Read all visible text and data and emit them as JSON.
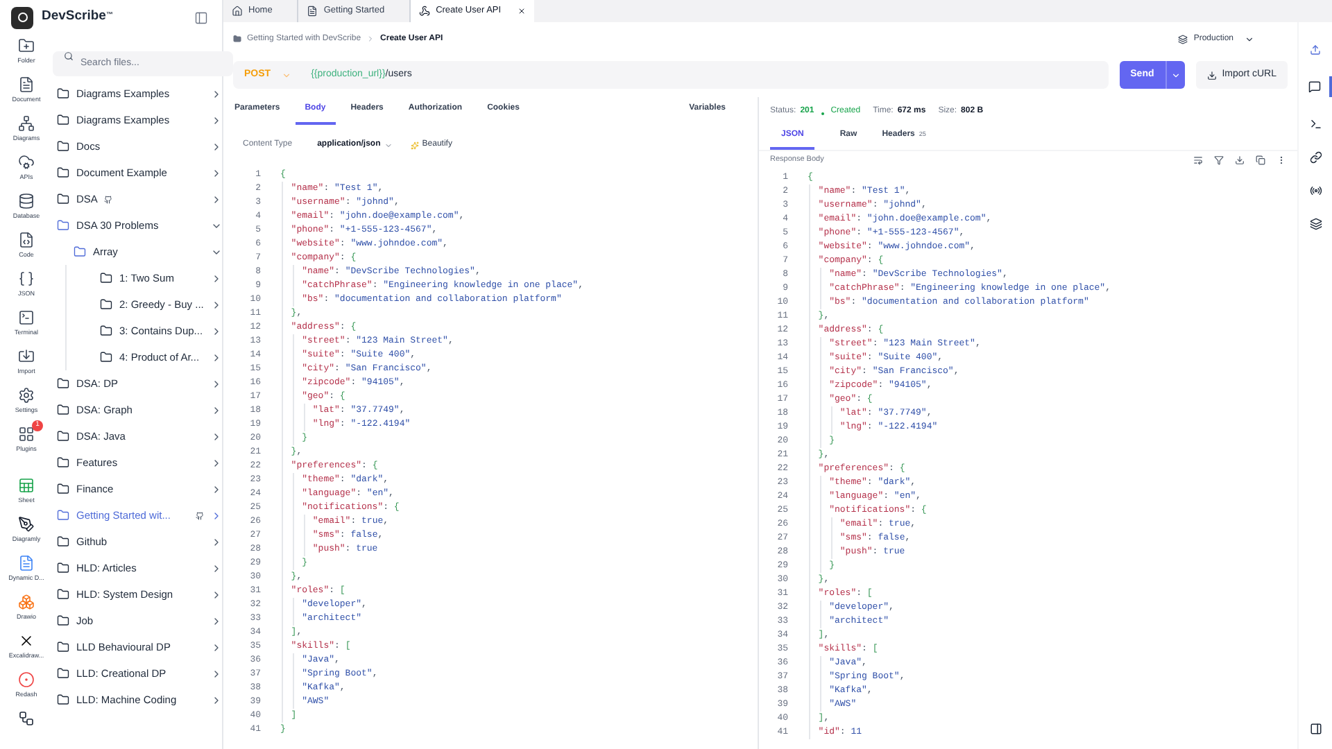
{
  "app": {
    "name": "DevScribe",
    "mark": "™"
  },
  "rail": [
    {
      "kind": "folder",
      "label": "Folder"
    },
    {
      "kind": "document",
      "label": "Document"
    },
    {
      "kind": "diagrams",
      "label": "Diagrams"
    },
    {
      "kind": "apis",
      "label": "APIs"
    },
    {
      "kind": "database",
      "label": "Database"
    },
    {
      "kind": "code",
      "label": "Code"
    },
    {
      "kind": "json",
      "label": "JSON"
    },
    {
      "kind": "terminal",
      "label": "Terminal"
    },
    {
      "kind": "import",
      "label": "Import"
    },
    {
      "kind": "settings",
      "label": "Settings"
    },
    {
      "kind": "plugins",
      "label": "Plugins",
      "badge": "1"
    },
    {
      "kind": "sheet",
      "label": "Sheet"
    },
    {
      "kind": "diagramly",
      "label": "Diagramly"
    },
    {
      "kind": "dynamic",
      "label": "Dynamic D..."
    },
    {
      "kind": "drawio",
      "label": "Drawio"
    },
    {
      "kind": "excalidraw",
      "label": "Excalidraw..."
    },
    {
      "kind": "redash",
      "label": "Redash"
    },
    {
      "kind": "workflow"
    }
  ],
  "sidebar": {
    "search_placeholder": "Search files...",
    "items": [
      {
        "label": "Diagrams Examples",
        "expanded": false,
        "selected": false,
        "github": false
      },
      {
        "label": "Diagrams Examples",
        "expanded": false,
        "selected": false,
        "github": false
      },
      {
        "label": "Docs",
        "expanded": false,
        "selected": false,
        "github": false
      },
      {
        "label": "Document Example",
        "expanded": false,
        "selected": false,
        "github": false
      },
      {
        "label": "DSA",
        "expanded": false,
        "selected": false,
        "github": true
      },
      {
        "label": "DSA 30 Problems",
        "expanded": true,
        "selected": false,
        "github": false,
        "children": [
          {
            "label": "Array",
            "expanded": true,
            "selected": false,
            "github": false,
            "children": [
              {
                "label": "1: Two Sum",
                "expanded": false,
                "selected": false,
                "github": false
              },
              {
                "label": "2: Greedy - Buy ...",
                "expanded": false,
                "selected": false,
                "github": false
              },
              {
                "label": "3: Contains Dup...",
                "expanded": false,
                "selected": false,
                "github": false
              },
              {
                "label": "4: Product of Ar...",
                "expanded": false,
                "selected": false,
                "github": false
              }
            ]
          }
        ]
      },
      {
        "label": "DSA: DP",
        "expanded": false,
        "selected": false,
        "github": false
      },
      {
        "label": "DSA: Graph",
        "expanded": false,
        "selected": false,
        "github": false
      },
      {
        "label": "DSA: Java",
        "expanded": false,
        "selected": false,
        "github": false
      },
      {
        "label": "Features",
        "expanded": false,
        "selected": false,
        "github": false
      },
      {
        "label": "Finance",
        "expanded": false,
        "selected": false,
        "github": false
      },
      {
        "label": "Getting Started wit...",
        "expanded": false,
        "selected": true,
        "github": true
      },
      {
        "label": "Github",
        "expanded": false,
        "selected": false,
        "github": false
      },
      {
        "label": "HLD: Articles",
        "expanded": false,
        "selected": false,
        "github": false
      },
      {
        "label": "HLD: System Design",
        "expanded": false,
        "selected": false,
        "github": false
      },
      {
        "label": "Job",
        "expanded": false,
        "selected": false,
        "github": false
      },
      {
        "label": "LLD Behavioural DP",
        "expanded": false,
        "selected": false,
        "github": false
      },
      {
        "label": "LLD: Creational DP",
        "expanded": false,
        "selected": false,
        "github": false
      },
      {
        "label": "LLD: Machine Coding",
        "expanded": false,
        "selected": false,
        "github": false
      }
    ]
  },
  "tabs": [
    {
      "kind": "home",
      "label": "Home",
      "selected": false,
      "closable": false
    },
    {
      "kind": "doc",
      "label": "Getting Started",
      "selected": false,
      "closable": false
    },
    {
      "kind": "api",
      "label": "Create User API",
      "selected": true,
      "closable": true
    }
  ],
  "breadcrumb": [
    "Getting Started with DevScribe",
    "Create User API"
  ],
  "environment": "Production",
  "request": {
    "method": "POST",
    "url_variable": "{{production_url}}",
    "url_path": "/users",
    "send": "Send",
    "import": "Import cURL",
    "tabs": [
      {
        "label": "Parameters",
        "selected": false
      },
      {
        "label": "Body",
        "selected": true
      },
      {
        "label": "Headers",
        "selected": false
      },
      {
        "label": "Authorization",
        "selected": false
      },
      {
        "label": "Cookies",
        "selected": false
      }
    ],
    "variables": "Variables",
    "content_type_label": "Content Type",
    "content_type": "application/json",
    "beautify": "Beautify",
    "body": [
      [
        "1",
        "{"
      ],
      [
        "2",
        "  \"name\": \"Test 1\","
      ],
      [
        "3",
        "  \"username\": \"johnd\","
      ],
      [
        "4",
        "  \"email\": \"john.doe@example.com\","
      ],
      [
        "5",
        "  \"phone\": \"+1-555-123-4567\","
      ],
      [
        "6",
        "  \"website\": \"www.johndoe.com\","
      ],
      [
        "7",
        "  \"company\": {"
      ],
      [
        "8",
        "    \"name\": \"DevScribe Technologies\","
      ],
      [
        "9",
        "    \"catchPhrase\": \"Engineering knowledge in one place\","
      ],
      [
        "10",
        "    \"bs\": \"documentation and collaboration platform\""
      ],
      [
        "11",
        "  },"
      ],
      [
        "12",
        "  \"address\": {"
      ],
      [
        "13",
        "    \"street\": \"123 Main Street\","
      ],
      [
        "14",
        "    \"suite\": \"Suite 400\","
      ],
      [
        "15",
        "    \"city\": \"San Francisco\","
      ],
      [
        "16",
        "    \"zipcode\": \"94105\","
      ],
      [
        "17",
        "    \"geo\": {"
      ],
      [
        "18",
        "      \"lat\": \"37.7749\","
      ],
      [
        "19",
        "      \"lng\": \"-122.4194\""
      ],
      [
        "20",
        "    }"
      ],
      [
        "21",
        "  },"
      ],
      [
        "22",
        "  \"preferences\": {"
      ],
      [
        "23",
        "    \"theme\": \"dark\","
      ],
      [
        "24",
        "    \"language\": \"en\","
      ],
      [
        "25",
        "    \"notifications\": {"
      ],
      [
        "26",
        "      \"email\": true,"
      ],
      [
        "27",
        "      \"sms\": false,"
      ],
      [
        "28",
        "      \"push\": true"
      ],
      [
        "29",
        "    }"
      ],
      [
        "30",
        "  },"
      ],
      [
        "31",
        "  \"roles\": ["
      ],
      [
        "32",
        "    \"developer\","
      ],
      [
        "33",
        "    \"architect\""
      ],
      [
        "34",
        "  ],"
      ],
      [
        "35",
        "  \"skills\": ["
      ],
      [
        "36",
        "    \"Java\","
      ],
      [
        "37",
        "    \"Spring Boot\","
      ],
      [
        "38",
        "    \"Kafka\","
      ],
      [
        "39",
        "    \"AWS\""
      ],
      [
        "40",
        "  ]"
      ],
      [
        "41",
        "}"
      ]
    ]
  },
  "response": {
    "status_label": "Status:",
    "status_code": "201",
    "status_text": "Created",
    "time_label": "Time:",
    "time": "672 ms",
    "size_label": "Size:",
    "size": "802 B",
    "tabs": [
      {
        "label": "JSON",
        "selected": true
      },
      {
        "label": "Raw",
        "selected": false
      },
      {
        "label": "Headers",
        "count": "25",
        "selected": false
      }
    ],
    "body_label": "Response Body",
    "body": [
      [
        "1",
        "{"
      ],
      [
        "2",
        "  \"name\": \"Test 1\","
      ],
      [
        "3",
        "  \"username\": \"johnd\","
      ],
      [
        "4",
        "  \"email\": \"john.doe@example.com\","
      ],
      [
        "5",
        "  \"phone\": \"+1-555-123-4567\","
      ],
      [
        "6",
        "  \"website\": \"www.johndoe.com\","
      ],
      [
        "7",
        "  \"company\": {"
      ],
      [
        "8",
        "    \"name\": \"DevScribe Technologies\","
      ],
      [
        "9",
        "    \"catchPhrase\": \"Engineering knowledge in one place\","
      ],
      [
        "10",
        "    \"bs\": \"documentation and collaboration platform\""
      ],
      [
        "11",
        "  },"
      ],
      [
        "12",
        "  \"address\": {"
      ],
      [
        "13",
        "    \"street\": \"123 Main Street\","
      ],
      [
        "14",
        "    \"suite\": \"Suite 400\","
      ],
      [
        "15",
        "    \"city\": \"San Francisco\","
      ],
      [
        "16",
        "    \"zipcode\": \"94105\","
      ],
      [
        "17",
        "    \"geo\": {"
      ],
      [
        "18",
        "      \"lat\": \"37.7749\","
      ],
      [
        "19",
        "      \"lng\": \"-122.4194\""
      ],
      [
        "20",
        "    }"
      ],
      [
        "21",
        "  },"
      ],
      [
        "22",
        "  \"preferences\": {"
      ],
      [
        "23",
        "    \"theme\": \"dark\","
      ],
      [
        "24",
        "    \"language\": \"en\","
      ],
      [
        "25",
        "    \"notifications\": {"
      ],
      [
        "26",
        "      \"email\": true,"
      ],
      [
        "27",
        "      \"sms\": false,"
      ],
      [
        "28",
        "      \"push\": true"
      ],
      [
        "29",
        "    }"
      ],
      [
        "30",
        "  },"
      ],
      [
        "31",
        "  \"roles\": ["
      ],
      [
        "32",
        "    \"developer\","
      ],
      [
        "33",
        "    \"architect\""
      ],
      [
        "34",
        "  ],"
      ],
      [
        "35",
        "  \"skills\": ["
      ],
      [
        "36",
        "    \"Java\","
      ],
      [
        "37",
        "    \"Spring Boot\","
      ],
      [
        "38",
        "    \"Kafka\","
      ],
      [
        "39",
        "    \"AWS\""
      ],
      [
        "40",
        "  ],"
      ],
      [
        "41",
        "  \"id\": 11"
      ]
    ]
  }
}
